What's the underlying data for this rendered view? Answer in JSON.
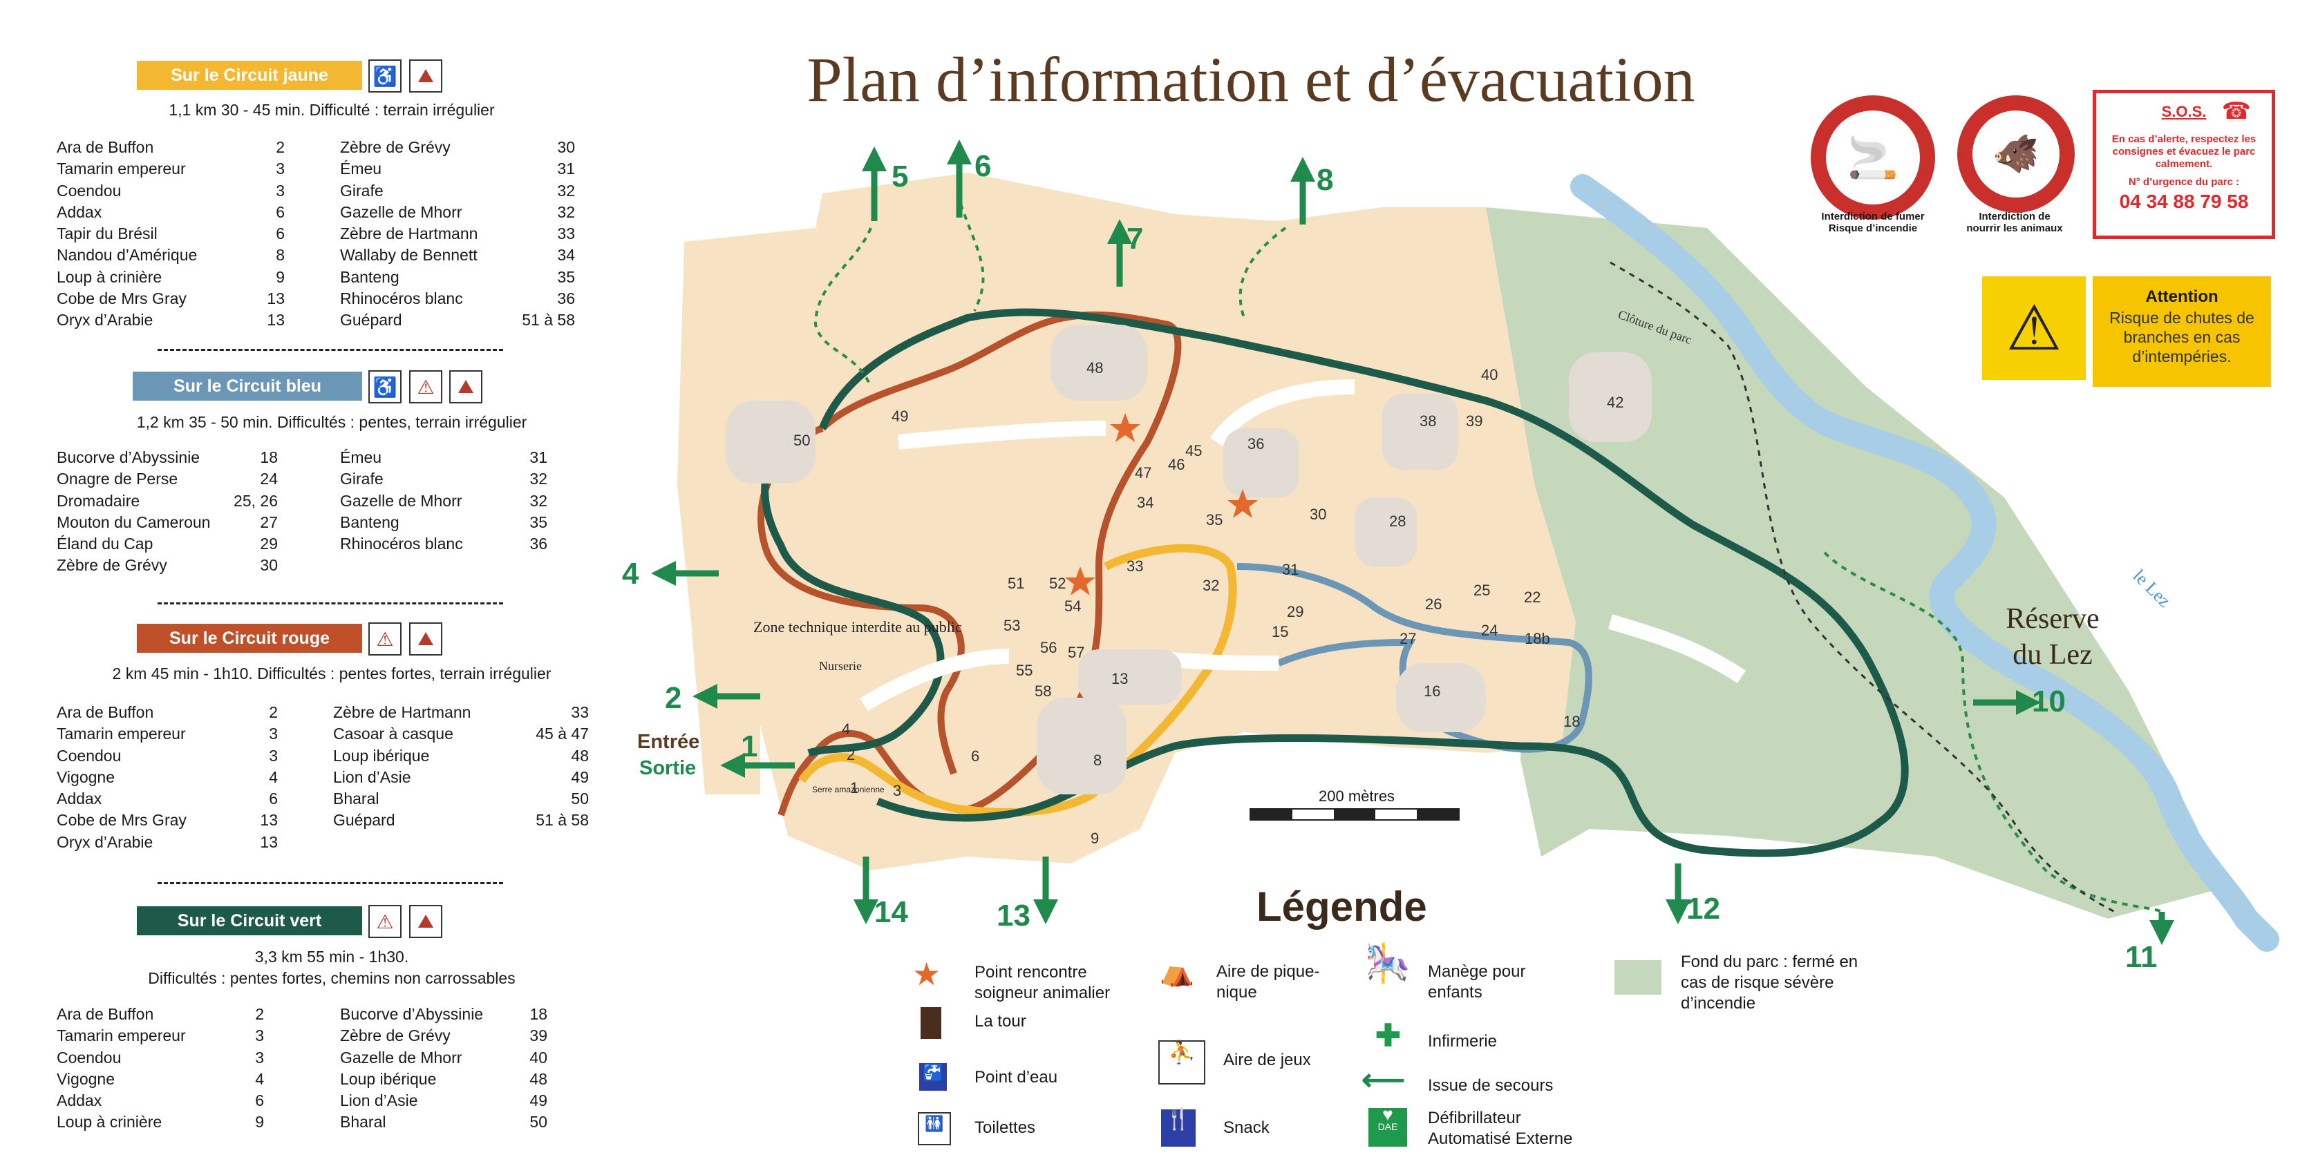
{
  "title": "Plan d’information et d’évacuation",
  "circuits": [
    {
      "key": "jaune",
      "label": "Sur le Circuit jaune",
      "color": "#f4b731",
      "meta": "1,1 km   30 - 45 min. Difficulté : terrain irrégulier",
      "left": [
        [
          "Ara de Buffon",
          "2"
        ],
        [
          "Tamarin empereur",
          "3"
        ],
        [
          "Coendou",
          "3"
        ],
        [
          "Addax",
          "6"
        ],
        [
          "Tapir du Brésil",
          "6"
        ],
        [
          "Nandou d’Amérique",
          "8"
        ],
        [
          "Loup à crinière",
          "9"
        ],
        [
          "Cobe de Mrs Gray",
          "13"
        ],
        [
          "Oryx d’Arabie",
          "13"
        ]
      ],
      "right": [
        [
          "Zèbre de Grévy",
          "30"
        ],
        [
          "Émeu",
          "31"
        ],
        [
          "Girafe",
          "32"
        ],
        [
          "Gazelle de Mhorr",
          "32"
        ],
        [
          "Zèbre de Hartmann",
          "33"
        ],
        [
          "Wallaby de Bennett",
          "34"
        ],
        [
          "Banteng",
          "35"
        ],
        [
          "Rhinocéros blanc",
          "36"
        ],
        [
          "Guépard",
          "51 à 58"
        ]
      ]
    },
    {
      "key": "bleu",
      "label": "Sur le Circuit bleu",
      "color": "#6b96b6",
      "meta": "1,2 km   35 - 50 min. Difficultés : pentes, terrain irrégulier",
      "left": [
        [
          "Bucorve d’Abyssinie",
          "18"
        ],
        [
          "Onagre de Perse",
          "24"
        ],
        [
          "Dromadaire",
          "25, 26"
        ],
        [
          "Mouton du Cameroun",
          "27"
        ],
        [
          "Éland du Cap",
          "29"
        ],
        [
          "Zèbre de Grévy",
          "30"
        ]
      ],
      "right": [
        [
          "Émeu",
          "31"
        ],
        [
          "Girafe",
          "32"
        ],
        [
          "Gazelle de Mhorr",
          "32"
        ],
        [
          "Banteng",
          "35"
        ],
        [
          "Rhinocéros blanc",
          "36"
        ]
      ]
    },
    {
      "key": "rouge",
      "label": "Sur le Circuit rouge",
      "color": "#c0502a",
      "meta": "2 km   45 min - 1h10. Difficultés : pentes fortes, terrain irrégulier",
      "left": [
        [
          "Ara de Buffon",
          "2"
        ],
        [
          "Tamarin empereur",
          "3"
        ],
        [
          "Coendou",
          "3"
        ],
        [
          "Vigogne",
          "4"
        ],
        [
          "Addax",
          "6"
        ],
        [
          "Cobe de Mrs Gray",
          "13"
        ],
        [
          "Oryx d’Arabie",
          "13"
        ]
      ],
      "right": [
        [
          "Zèbre de Hartmann",
          "33"
        ],
        [
          "Casoar à casque",
          "45 à 47"
        ],
        [
          "Loup ibérique",
          "48"
        ],
        [
          "Lion d’Asie",
          "49"
        ],
        [
          "Bharal",
          "50"
        ],
        [
          "Guépard",
          "51 à 58"
        ]
      ]
    },
    {
      "key": "vert",
      "label": "Sur le Circuit vert",
      "color": "#1e5a4a",
      "meta": "3,3 km   55 min - 1h30.",
      "meta2": "Difficultés : pentes fortes, chemins non carrossables",
      "left": [
        [
          "Ara de Buffon",
          "2"
        ],
        [
          "Tamarin empereur",
          "3"
        ],
        [
          "Coendou",
          "3"
        ],
        [
          "Vigogne",
          "4"
        ],
        [
          "Addax",
          "6"
        ],
        [
          "Loup à crinière",
          "9"
        ]
      ],
      "right": [
        [
          "Bucorve d’Abyssinie",
          "18"
        ],
        [
          "Zèbre de Grévy",
          "39"
        ],
        [
          "Gazelle de Mhorr",
          "40"
        ],
        [
          "Loup ibérique",
          "48"
        ],
        [
          "Lion d’Asie",
          "49"
        ],
        [
          "Bharal",
          "50"
        ]
      ]
    }
  ],
  "signs": {
    "no_smoking": "Interdiction de fumer\nRisque d’incendie",
    "no_feeding": "Interdiction de\nnourrir les animaux",
    "sos_title": "S.O.S.",
    "sos_text": "En cas d’alerte, respectez les consignes et évacuez le parc calmement.",
    "sos_urgence_label": "N° d’urgence du parc :",
    "sos_phone": "04 34 88 79 58",
    "attention_title": "Attention",
    "attention_text": "Risque de chutes de branches en cas d’intempéries."
  },
  "map": {
    "entry": "Entrée",
    "exit": "Sortie",
    "zone_technique": "Zone technique interdite au public",
    "nurserie": "Nurserie",
    "serre": "Serre amazonienne",
    "cloture": "Clôture du parc",
    "reserve": "Réserve du Lez",
    "river": "le Lez",
    "scale": "200 mètres",
    "exits": [
      "1",
      "2",
      "4",
      "5",
      "6",
      "7",
      "8",
      "10",
      "11",
      "12",
      "13",
      "14"
    ],
    "enclosures": [
      "2",
      "4",
      "6",
      "8",
      "9",
      "13",
      "15",
      "16",
      "18",
      "18b",
      "22",
      "24",
      "25",
      "26",
      "27",
      "28",
      "29",
      "30",
      "31",
      "32",
      "33",
      "34",
      "35",
      "36",
      "38",
      "39",
      "40",
      "42",
      "45",
      "46",
      "47",
      "48",
      "49",
      "50",
      "51",
      "52",
      "53",
      "54",
      "55",
      "56",
      "57",
      "58"
    ],
    "colors": {
      "park": "#f7e3c4",
      "green_zone": "#c5d8bc",
      "river": "#a8cde6",
      "enclosure": "#e2dcd5",
      "yellow": "#f4b731",
      "red": "#b7532c",
      "blue": "#6b96b6",
      "green": "#1e5a4a",
      "exit": "#1f8a4c"
    }
  },
  "legend": {
    "title": "Légende",
    "items": [
      {
        "icon": "star-icon",
        "label": "Point rencontre soigneur animalier"
      },
      {
        "icon": "tower-icon",
        "label": "La tour"
      },
      {
        "icon": "water-point-icon",
        "label": "Point d’eau"
      },
      {
        "icon": "toilets-icon",
        "label": "Toilettes"
      },
      {
        "icon": "picnic-icon",
        "label": "Aire de pique-nique"
      },
      {
        "icon": "playground-icon",
        "label": "Aire de jeux"
      },
      {
        "icon": "snack-icon",
        "label": "Snack"
      },
      {
        "icon": "carousel-icon",
        "label": "Manège pour enfants"
      },
      {
        "icon": "first-aid-icon",
        "label": "Infirmerie"
      },
      {
        "icon": "emergency-exit-icon",
        "label": "Issue de secours"
      },
      {
        "icon": "defibrillator-icon",
        "label": "Défibrillateur Automatisé Externe"
      },
      {
        "icon": "park-background-swatch",
        "label": "Fond du parc : fermé en cas de risque sévère d’incendie"
      }
    ],
    "dae": "DAE"
  }
}
